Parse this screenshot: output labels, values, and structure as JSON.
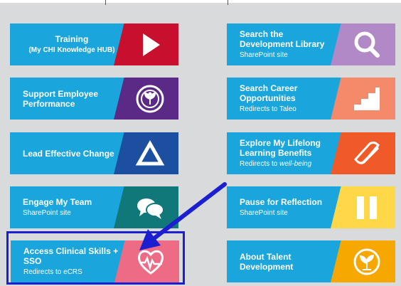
{
  "tiles": {
    "training": {
      "title": "Training",
      "sub": "(My CHI Knowledge HUB)",
      "icon": "play-icon",
      "color": "#c8102e"
    },
    "support_performance": {
      "title": "Support Employee Performance",
      "sub": "",
      "icon": "seedling-emblem-icon",
      "color": "#5b2a86"
    },
    "lead_change": {
      "title": "Lead Effective Change",
      "sub": "",
      "icon": "triangle-icon",
      "color": "#1c4fa0"
    },
    "engage_team": {
      "title": "Engage My Team",
      "sub": "SharePoint site",
      "icon": "chat-bubbles-icon",
      "color": "#11787a"
    },
    "clinical_skills": {
      "title": "Access Clinical Skills + SSO",
      "sub": "Redirects to eCRS",
      "icon": "heart-pulse-icon",
      "color": "#ee6b86"
    },
    "dev_library": {
      "title": "Search the Development Library",
      "sub": "SharePoint site",
      "icon": "magnifier-icon",
      "color": "#b189c7"
    },
    "career": {
      "title": "Search Career Opportunities",
      "sub": "Redirects to Taleo",
      "icon": "stairs-icon",
      "color": "#f48a6a"
    },
    "lifelong": {
      "title": "Explore My Lifelong Learning Benefits",
      "sub_prefix": "Redirects to ",
      "sub_italic": "well-being",
      "icon": "book-icon",
      "color": "#f05a28"
    },
    "reflection": {
      "title": "Pause for Reflection",
      "sub": "SharePoint site",
      "icon": "pause-icon",
      "color": "#ffd84a"
    },
    "about": {
      "title": "About Talent Development",
      "sub": "",
      "icon": "sprout-circle-icon",
      "color": "#f6a800"
    }
  },
  "colors": {
    "tile_blue": "#1aa6dd",
    "highlight": "#1c1fd0"
  }
}
